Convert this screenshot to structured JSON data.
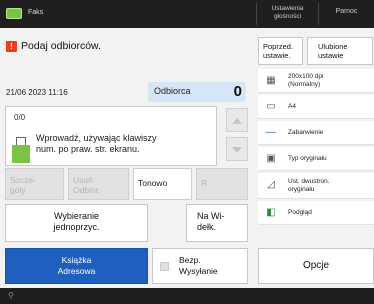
{
  "topbar": {
    "fax_tab": "Faks",
    "settings": [
      "Ustawienia",
      "głośności"
    ],
    "monitor": "Pamoc"
  },
  "warning": {
    "icon": "warning-icon",
    "text": "Podaj odbiorców."
  },
  "datetime": "21/06 2023 11:16",
  "recipients": {
    "label": "Odbiorca",
    "count": "0"
  },
  "input": {
    "count": "0/0",
    "hint_line1": "Wprowadź, używając klawiszy",
    "hint_line2": "num. po praw. str. ekranu."
  },
  "keys": {
    "details": [
      "Szcze-",
      "góły"
    ],
    "delete": [
      "Usuń",
      "Odbior."
    ],
    "tone": "Tonowo",
    "r": "R"
  },
  "buttons": {
    "onetouch": [
      "Wybieranie",
      "jednoprzyc."
    ],
    "hook": [
      "Na Wi-",
      "dełk."
    ],
    "addressbook": [
      "Książka",
      "Adresowa"
    ],
    "direct": [
      "Bezp.",
      "Wysyłanie"
    ],
    "options": "Opcje"
  },
  "right_panel": {
    "prev_settings": [
      "Poprzed.",
      "ustawie."
    ],
    "fav_settings": [
      "Ulubione",
      "ustawie"
    ],
    "rows": [
      {
        "icon": "resolution-icon",
        "label1": "200x100 dpi",
        "label2": "(Normalny)"
      },
      {
        "icon": "paper-size-icon",
        "label1": "A4",
        "label2": ""
      },
      {
        "icon": "density-icon",
        "label1": "Zabarwienie",
        "label2": ""
      },
      {
        "icon": "original-type-icon",
        "label1": "Typ oryginału",
        "label2": ""
      },
      {
        "icon": "duplex-icon",
        "label1": "Ust. dwustron.",
        "label2": "oryginału"
      },
      {
        "icon": "preview-icon",
        "label1": "Podgląd",
        "label2": ""
      }
    ]
  },
  "colors": {
    "accent_blue": "#1f5fbf",
    "badge_blue": "#d6e6f6",
    "fax_green": "#7cc243",
    "warning_red": "#e8401c"
  }
}
